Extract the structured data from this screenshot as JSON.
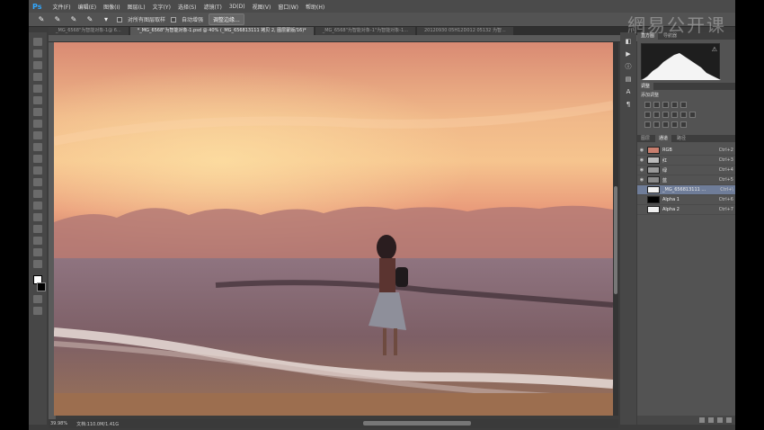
{
  "menu": {
    "logo": "Ps",
    "items": [
      "文件(F)",
      "编辑(E)",
      "图像(I)",
      "图层(L)",
      "文字(Y)",
      "选择(S)",
      "滤镜(T)",
      "3D(D)",
      "视图(V)",
      "窗口(W)",
      "帮助(H)"
    ]
  },
  "options": {
    "sample_all_layers": "对所有图层取样",
    "auto_enhance": "自动增强",
    "refine_edge": "调整边缘..."
  },
  "tabs": [
    "_MG_6568\"为智能对象-1@ 6...",
    "*_MG_6568\"为智能对象-1.psd @ 40% (_MG_656813111 拷贝 2, 图层蒙版/16)*",
    "_MG_6568\"为智能对象-1\"为智能对象-1...",
    "20120930 05H12D012 05132 为智..."
  ],
  "status": {
    "zoom": "39.98%",
    "doc": "文档:110.0M/1.41G"
  },
  "panels": {
    "histogram_tabs": [
      "直方图",
      "导航器"
    ],
    "adjust_tab": "调整",
    "adjust_label": "添加调整",
    "layers_tabs": [
      "图层",
      "通道",
      "路径"
    ],
    "channels": [
      {
        "name": "RGB",
        "key": "Ctrl+2",
        "color": "#c87e6e"
      },
      {
        "name": "红",
        "key": "Ctrl+3",
        "color": "#bbbbbb"
      },
      {
        "name": "绿",
        "key": "Ctrl+4",
        "color": "#999999"
      },
      {
        "name": "蓝",
        "key": "Ctrl+5",
        "color": "#8a8a8a"
      },
      {
        "name": "_MG_656813111 ...",
        "key": "Ctrl+\\",
        "color": "#f0f0f0"
      },
      {
        "name": "Alpha 1",
        "key": "Ctrl+6",
        "color": "#000000"
      },
      {
        "name": "Alpha 2",
        "key": "Ctrl+7",
        "color": "#eeeeee"
      }
    ]
  },
  "watermark": "網易公开课"
}
